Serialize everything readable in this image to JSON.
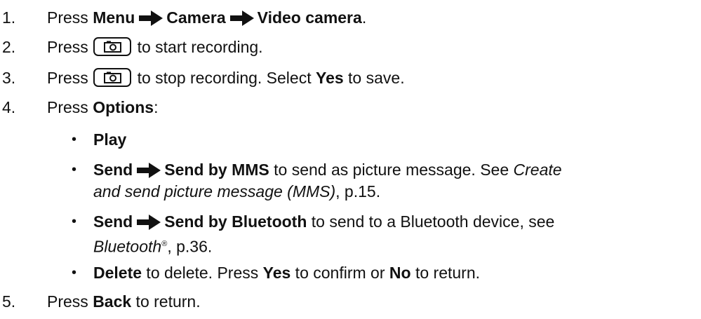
{
  "steps": [
    {
      "number": "1.",
      "pre": "Press ",
      "menu": "Menu",
      "camera": "Camera",
      "video": "Video camera",
      "post": "."
    },
    {
      "number": "2.",
      "pre": "Press ",
      "post": " to start recording."
    },
    {
      "number": "3.",
      "pre": "Press ",
      "mid": " to stop recording. Select ",
      "yes": "Yes",
      "post": " to save."
    },
    {
      "number": "4.",
      "pre": "Press ",
      "options": "Options",
      "post": ":"
    },
    {
      "number": "5.",
      "pre": "Press ",
      "back": "Back",
      "post": " to return."
    }
  ],
  "options": [
    {
      "bullet": "•",
      "label": "Play"
    },
    {
      "bullet": "•",
      "send": "Send",
      "target": "Send by MMS",
      "text1": " to send as picture message. See ",
      "ref": "Create",
      "ref2": "and send picture message (MMS)",
      "page": ", p.15."
    },
    {
      "bullet": "•",
      "send": "Send",
      "target": "Send by Bluetooth",
      "text1": " to send to a Bluetooth device, see",
      "ref": "Bluetooth",
      "reg": "®",
      "page": ", p.36."
    },
    {
      "bullet": "•",
      "label": "Delete",
      "text1": " to delete. Press ",
      "yes": "Yes",
      "text2": " to confirm or ",
      "no": "No",
      "text3": " to return."
    }
  ],
  "icons": {
    "arrow": "right-arrow-icon",
    "camera_key": "camera-key-icon"
  }
}
